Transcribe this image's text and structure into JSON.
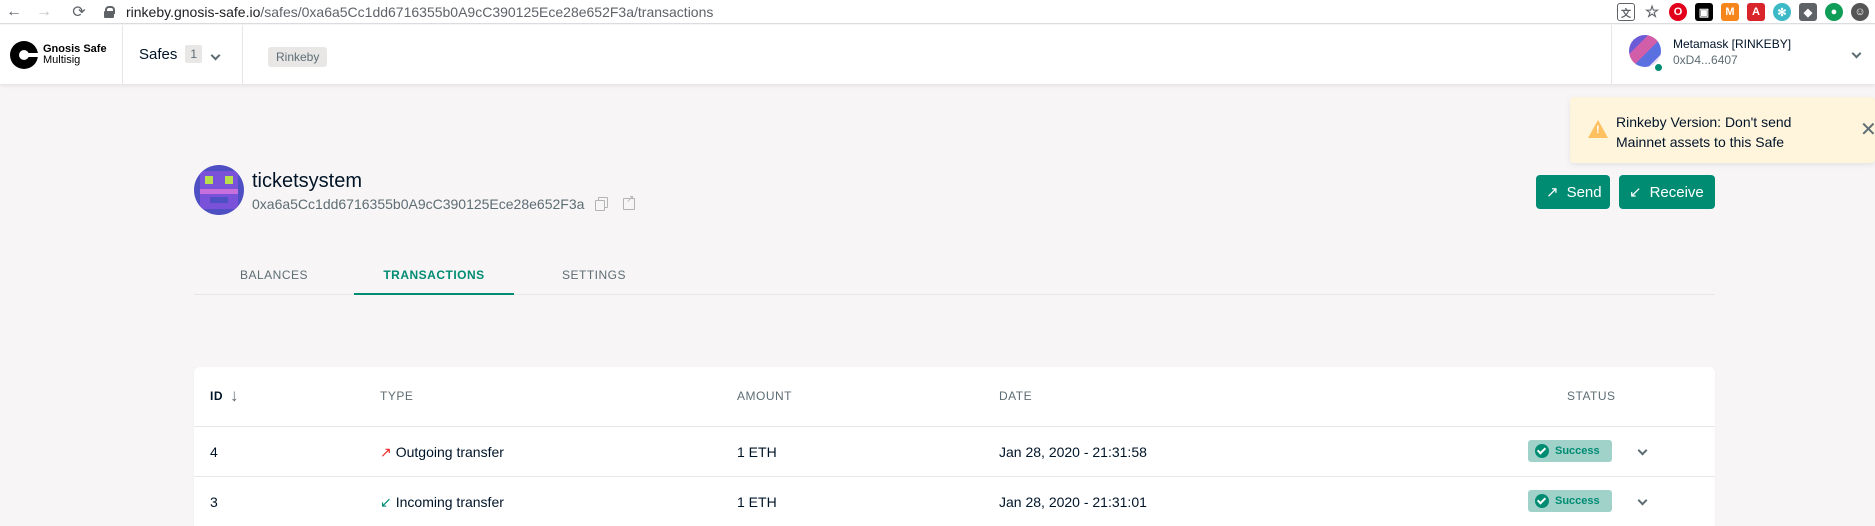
{
  "browser": {
    "url_host": "rinkeby.gnosis-safe.io",
    "url_path": "/safes/0xa6a5Cc1dd6716355b0A9cC390125Ece28e652F3a/transactions",
    "extensions": [
      {
        "name": "translate-icon",
        "color": "#5f6368"
      },
      {
        "name": "star-icon",
        "color": "#5f6368"
      },
      {
        "name": "opera-icon",
        "color": "#e2001a"
      },
      {
        "name": "extension-icon",
        "color": "#000000"
      },
      {
        "name": "metamask-icon",
        "color": "#f6851b"
      },
      {
        "name": "pdf-icon",
        "color": "#d9252a"
      },
      {
        "name": "react-icon",
        "color": "#3cb9c6"
      },
      {
        "name": "cube-icon",
        "color": "#5f6368"
      },
      {
        "name": "green-circle-icon",
        "color": "#0f9d58"
      },
      {
        "name": "profile-icon",
        "color": "#555555"
      }
    ]
  },
  "header": {
    "brand_name": "Gnosis Safe",
    "brand_sub": "Multisig",
    "safes_label": "Safes",
    "safes_count": "1",
    "network": "Rinkeby",
    "account_name": "Metamask [RINKEBY]",
    "account_address": "0xD4...6407"
  },
  "toast": {
    "message": "Rinkeby Version: Don't send Mainnet assets to this Safe",
    "close": "✕"
  },
  "safe": {
    "name": "ticketsystem",
    "address": "0xa6a5Cc1dd6716355b0A9cC390125Ece28e652F3a"
  },
  "actions": {
    "send_label": "Send",
    "receive_label": "Receive"
  },
  "tabs": [
    {
      "label": "BALANCES",
      "active": false
    },
    {
      "label": "TRANSACTIONS",
      "active": true
    },
    {
      "label": "SETTINGS",
      "active": false
    }
  ],
  "table": {
    "columns": [
      "ID",
      "TYPE",
      "AMOUNT",
      "DATE",
      "STATUS"
    ],
    "rows": [
      {
        "id": "4",
        "type": "Outgoing transfer",
        "direction": "out",
        "amount": "1 ETH",
        "date": "Jan 28, 2020 - 21:31:58",
        "status": "Success"
      },
      {
        "id": "3",
        "type": "Incoming transfer",
        "direction": "in",
        "amount": "1 ETH",
        "date": "Jan 28, 2020 - 21:31:01",
        "status": "Success"
      }
    ]
  },
  "colors": {
    "primary": "#008c73",
    "warning_bg": "#fff4dc",
    "outgoing": "#f02525"
  }
}
